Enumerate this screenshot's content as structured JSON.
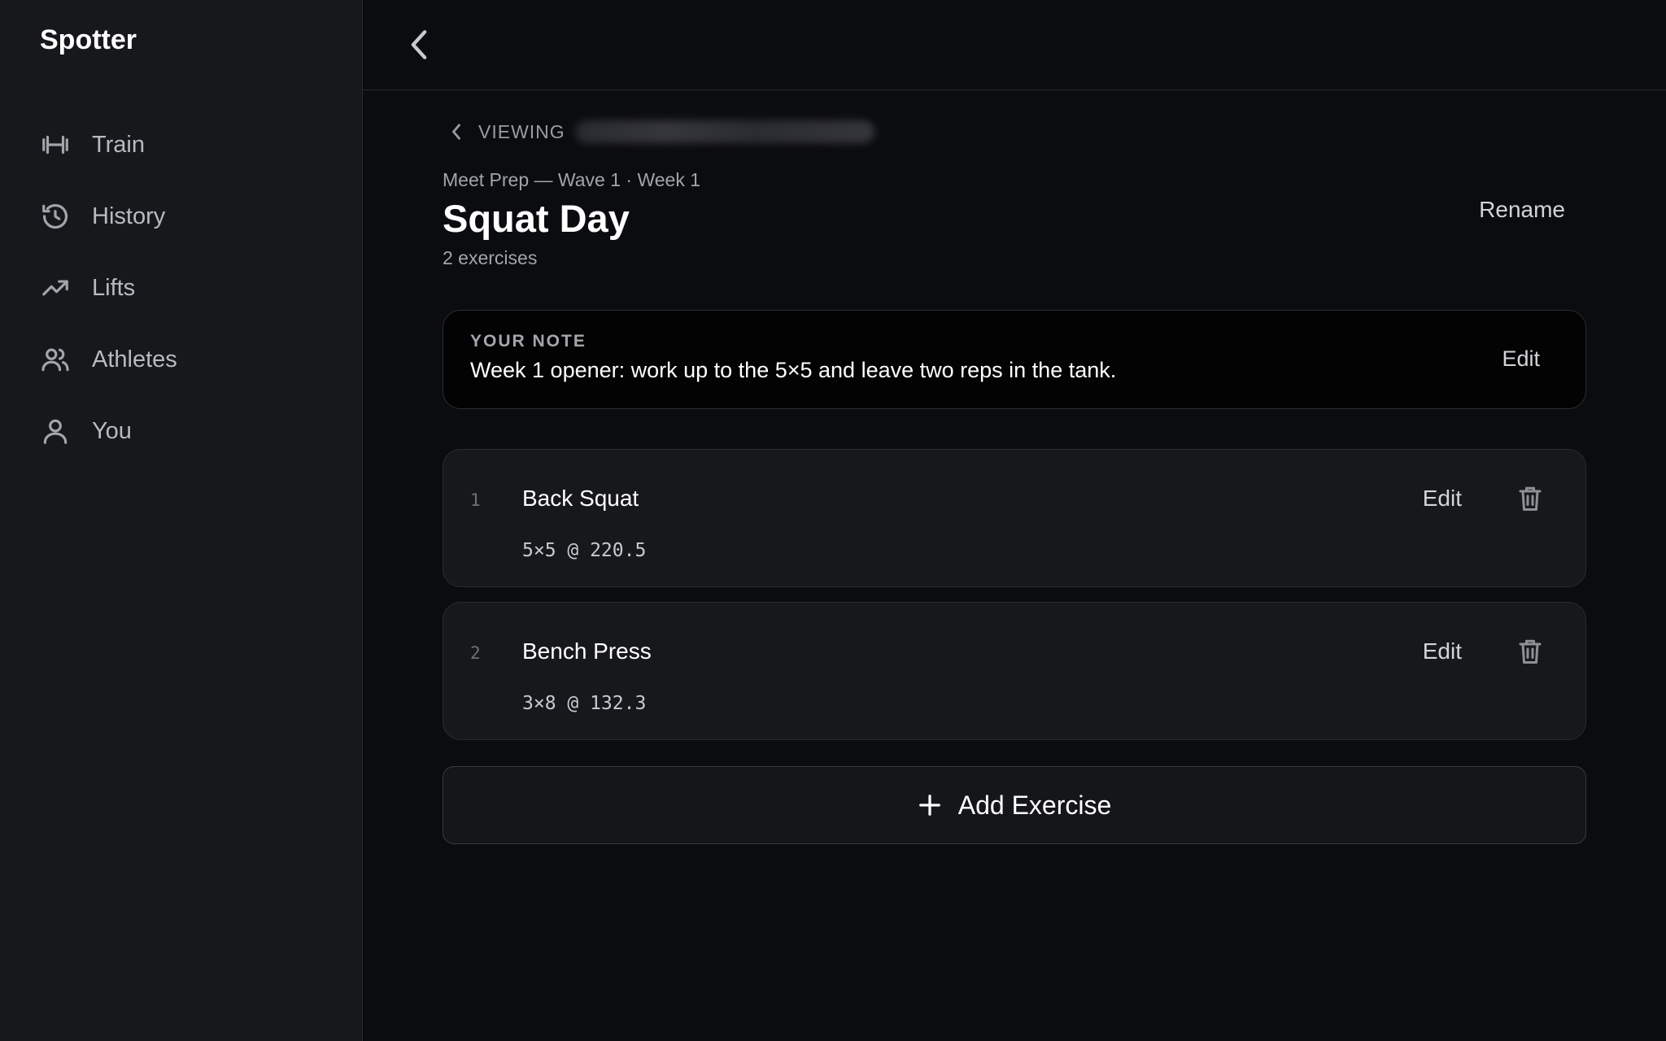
{
  "app": {
    "name": "Spotter"
  },
  "sidebar": {
    "items": [
      {
        "label": "Train",
        "icon": "dumbbell-icon"
      },
      {
        "label": "History",
        "icon": "history-icon"
      },
      {
        "label": "Lifts",
        "icon": "trending-up-icon"
      },
      {
        "label": "Athletes",
        "icon": "users-icon"
      },
      {
        "label": "You",
        "icon": "user-icon"
      }
    ]
  },
  "topbar": {
    "back_icon": "chevron-left-icon"
  },
  "viewing": {
    "label": "VIEWING"
  },
  "workout": {
    "eyebrow": "Meet Prep — Wave 1 · Week 1",
    "title": "Squat Day",
    "subtitle": "2 exercises",
    "rename_label": "Rename"
  },
  "note": {
    "label": "YOUR NOTE",
    "text": "Week 1 opener: work up to the 5×5 and leave two reps in the tank.",
    "edit_label": "Edit"
  },
  "exercises": [
    {
      "num": "1",
      "name": "Back Squat",
      "spec": "5×5 @ 220.5",
      "edit_label": "Edit"
    },
    {
      "num": "2",
      "name": "Bench Press",
      "spec": "3×8 @ 132.3",
      "edit_label": "Edit"
    }
  ],
  "add_button": {
    "label": "Add Exercise"
  },
  "colors": {
    "background": "#0b0c0f",
    "sidebar": "#17181c",
    "card": "#17181c",
    "note": "#030304"
  }
}
